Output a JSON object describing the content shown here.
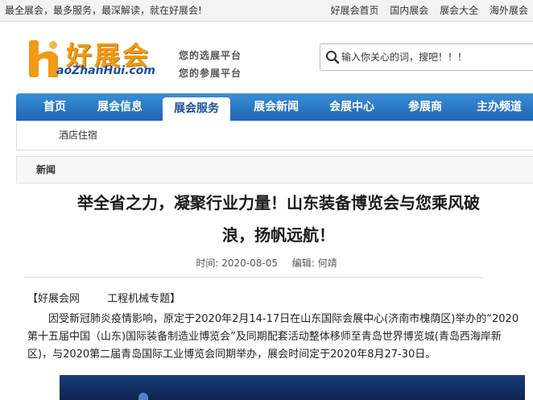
{
  "topbar": {
    "slogan": "最全展会，最多服务，最深解读，就在好展会!",
    "links": [
      "好展会首页",
      "国内展会",
      "展会大全",
      "海外展会"
    ]
  },
  "logo": {
    "cn": "好展会",
    "en": "aoZhanHui.com",
    "tagline1": "您的选展平台",
    "tagline2": "您的参展平台"
  },
  "search": {
    "placeholder": "输入你关心的词，搜吧！！！"
  },
  "nav": {
    "items": [
      "首页",
      "展会信息",
      "展会服务",
      "展会新闻",
      "会展中心",
      "参展商",
      "主办频道"
    ],
    "active": "展会服务"
  },
  "subnav": {
    "item": "酒店住宿"
  },
  "breadcrumb": {
    "label": "新闻"
  },
  "article": {
    "title_line1": "举全省之力，凝聚行业力量！山东装备博览会与您乘风破",
    "title_line2": "浪，扬帆远航！",
    "time_label": "时间:",
    "time": "2020-08-05",
    "editor_label": "编辑:",
    "editor": "何靖",
    "source": "【好展会网",
    "topic": "工程机械专题】",
    "paragraph": "因受新冠肺炎疫情影响，原定于2020年2月14-17日在山东国际会展中心(济南市槐荫区)举办的“2020第十五届中国（山东)国际装备制造业博览会”及同期配套活动整体移师至青岛世界博览城(青岛西海岸新区)，与2020第二届青岛国际工业博览会同期举办，展会时间定于2020年8月27-30日。"
  },
  "colors": {
    "nav": "#1d66b5",
    "logo": "#f09a15",
    "brand_blue": "#1c4f9c"
  }
}
